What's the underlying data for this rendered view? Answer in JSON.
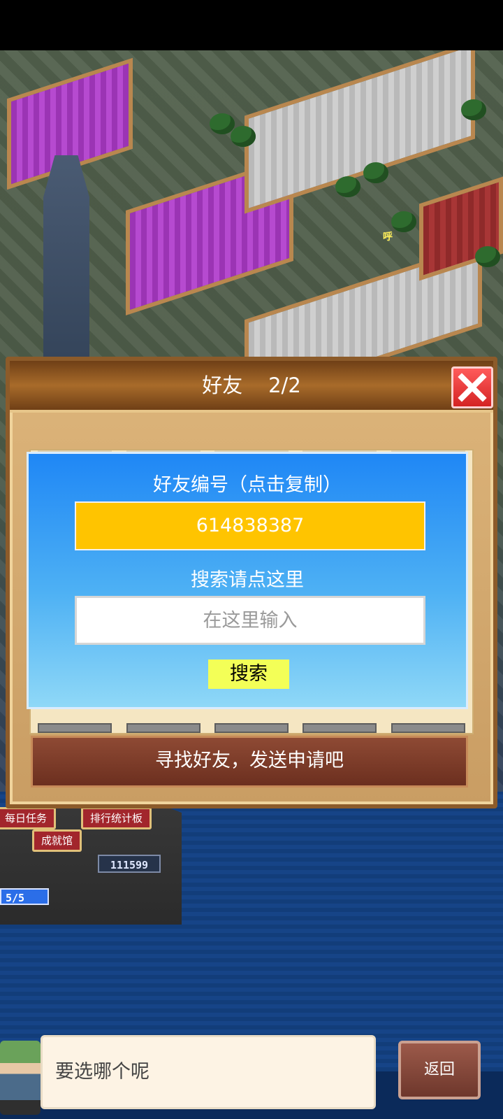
{
  "dialog": {
    "title": "好友",
    "page": "2/2",
    "friend_id_label": "好友编号（点击复制）",
    "friend_id": "614838387",
    "search_hint": "搜索请点这里",
    "search_placeholder": "在这里输入",
    "search_button": "搜索",
    "find_friends_button": "寻找好友，发送申请吧"
  },
  "background": {
    "daily_task": "每日任务",
    "leaderboard": "排行统计板",
    "achievements": "成就馆",
    "score": "111599",
    "stamina": "5/5",
    "floating_text": "呼"
  },
  "bottom": {
    "speech": "要选哪个呢",
    "back_button": "返回"
  },
  "colors": {
    "id_field": "#ffc400",
    "search_button": "#f3ff57",
    "close_button": "#d42323"
  }
}
